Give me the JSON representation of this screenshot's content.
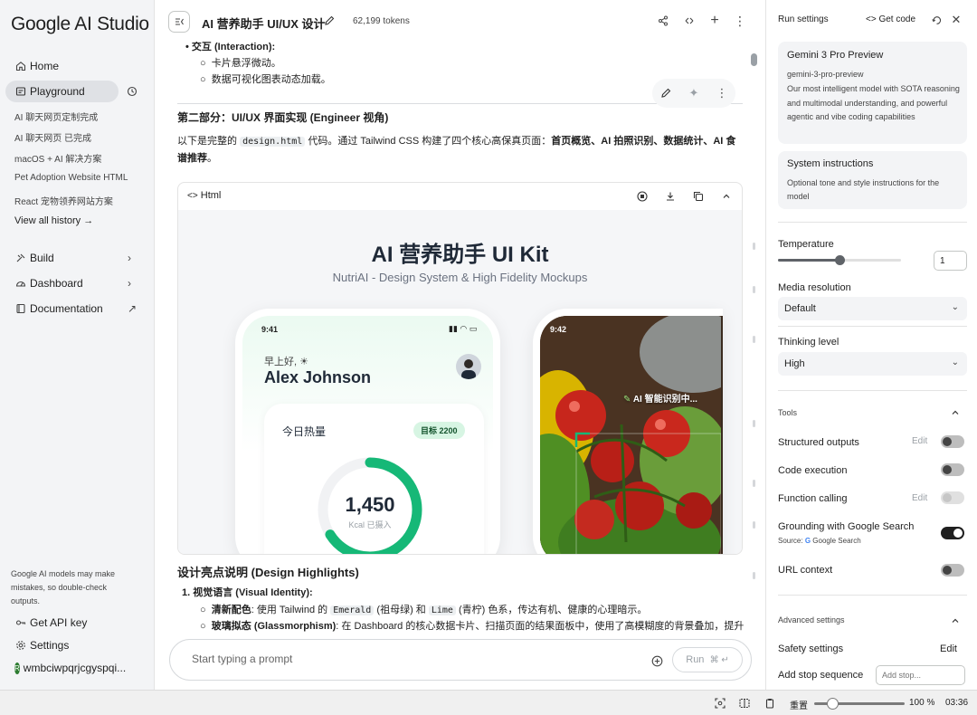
{
  "sidebar": {
    "logo": "Google AI Studio",
    "home": "Home",
    "playground": "Playground",
    "history": [
      "AI 聊天网页定制完成",
      "AI 聊天网页 已完成",
      "macOS + AI 解决方案",
      "Pet Adoption Website HTML",
      "React 宠物领养网站方案"
    ],
    "view_all_history": "View all history",
    "build": "Build",
    "dashboard": "Dashboard",
    "documentation": "Documentation",
    "disclaimer": "Google AI models may make mistakes, so double-check outputs.",
    "get_api_key": "Get API key",
    "settings": "Settings",
    "account": "wmbciwpqrjcgyspqi...",
    "avatar_initial": "R"
  },
  "header": {
    "title": "AI 营养助手 UI/UX 设计",
    "tokens": "62,199 tokens"
  },
  "chat": {
    "interaction_head": "交互 (Interaction):",
    "bullet1": "卡片悬浮微动。",
    "bullet2": "数据可视化图表动态加载。",
    "section2_title": "第二部分：UI/UX 界面实现 (Engineer 视角)",
    "intro_a": "以下是完整的 ",
    "intro_code": "design.html",
    "intro_b": " 代码。通过 Tailwind CSS 构建了四个核心高保真页面：",
    "intro_bold": "首页概览、AI 拍照识别、数据统计、AI 食谱推荐",
    "intro_end": "。",
    "code_lang": "Html",
    "preview": {
      "kit_title": "AI 营养助手 UI Kit",
      "kit_subtitle": "NutriAI - Design System & High Fidelity Mockups",
      "phone1_time": "9:41",
      "greeting": "早上好, ☀",
      "user_name": "Alex Johnson",
      "today_heat": "今日热量",
      "target": "目标 2200",
      "kcal_value": "1,450",
      "kcal_label": "Kcal 已摄入",
      "kcal_progress": 0.66,
      "phone2_time": "9:42",
      "ai_scanning": "AI 智能识别中..."
    },
    "design_title": "设计亮点说明 (Design Highlights)",
    "item1_num": "1.",
    "item1": "视觉语言 (Visual Identity):",
    "sub1_bold": "清新配色",
    "sub1_a": ": 使用 Tailwind 的 ",
    "sub1_code1": "Emerald",
    "sub1_b": " (祖母绿) 和 ",
    "sub1_code2": "Lime",
    "sub1_c": " (青柠) 色系，传达有机、健康的心理暗示。",
    "sub2_bold": "玻璃拟态 (Glassmorphism)",
    "sub2_text": ": 在 Dashboard 的核心数据卡片、扫描页面的结果面板中，使用了高模糊度的背景叠加，提升"
  },
  "composer": {
    "placeholder": "Start typing a prompt",
    "run": "Run",
    "shortcut": "⌘ ↵"
  },
  "right_panel": {
    "title": "Run settings",
    "get_code": "Get code",
    "model_name": "Gemini 3 Pro Preview",
    "model_id": "gemini-3-pro-preview",
    "model_desc": "Our most intelligent model with SOTA reasoning and multimodal understanding, and powerful agentic and vibe coding capabilities",
    "system_title": "System instructions",
    "system_desc": "Optional tone and style instructions for the model",
    "temperature_label": "Temperature",
    "temperature_value": "1",
    "temperature_fraction": 0.5,
    "media_label": "Media resolution",
    "media_value": "Default",
    "thinking_label": "Thinking level",
    "thinking_value": "High",
    "tools_label": "Tools",
    "structured": "Structured outputs",
    "code_exec": "Code execution",
    "function_calling": "Function calling",
    "grounding": "Grounding with Google Search",
    "source_label": "Source:",
    "source_value": "Google Search",
    "url_context": "URL context",
    "edit": "Edit",
    "advanced": "Advanced settings",
    "safety": "Safety settings",
    "safety_edit": "Edit",
    "stop_seq": "Add stop sequence",
    "stop_placeholder": "Add stop..."
  },
  "statusbar": {
    "reset": "重置",
    "zoom": "100 %",
    "zoom_fraction": 0.2,
    "time": "03:36"
  }
}
